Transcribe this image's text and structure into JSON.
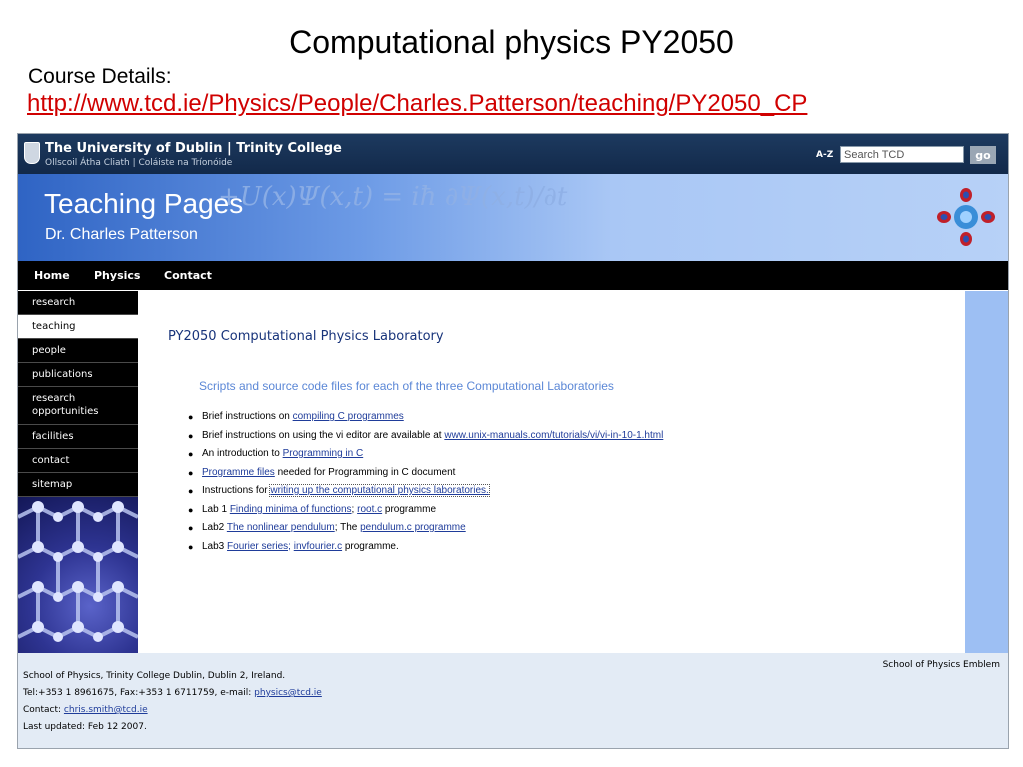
{
  "slide": {
    "title": "Computational physics PY2050",
    "course_label": "Course Details:",
    "course_url": "http://www.tcd.ie/Physics/People/Charles.Patterson/teaching/PY2050_CP"
  },
  "header": {
    "university": "The University of Dublin | Trinity College",
    "university_irish": "Ollscoil Átha Cliath | Coláiste na Tríonóide",
    "az_label": "A-Z",
    "search_placeholder": "Search TCD",
    "go_label": "go"
  },
  "banner": {
    "title": "Teaching Pages",
    "subtitle": "Dr. Charles Patterson"
  },
  "nav": {
    "items": [
      "Home",
      "Physics",
      "Contact"
    ]
  },
  "sidebar": {
    "items": [
      {
        "label": "research"
      },
      {
        "label": "teaching",
        "active": true
      },
      {
        "label": "people"
      },
      {
        "label": "publications"
      },
      {
        "label": "research opportunities"
      },
      {
        "label": "facilities"
      },
      {
        "label": "contact"
      },
      {
        "label": "sitemap"
      }
    ]
  },
  "main": {
    "heading": "PY2050 Computational Physics Laboratory",
    "subheading": "Scripts and source code files for each of the three Computational Laboratories",
    "list": [
      {
        "t1": "Brief instructions on ",
        "l1": "compiling C programmes"
      },
      {
        "t1": "Brief instructions on using the vi editor are available at ",
        "l1": "www.unix-manuals.com/tutorials/vi/vi-in-10-1.html"
      },
      {
        "t1": "An introduction to ",
        "l1": "Programming in C"
      },
      {
        "l1": "Programme files",
        "t2": " needed for Programming in C document"
      },
      {
        "t1": "Instructions for ",
        "l1": "writing up the computational physics laboratories."
      },
      {
        "t1": "Lab 1 ",
        "l1": "Finding minima of functions",
        "t2": "; ",
        "l2": "root.c",
        "t3": " programme"
      },
      {
        "t1": "Lab2 ",
        "l1": "The nonlinear pendulum",
        "t2": "; The ",
        "l2": "pendulum.c programme"
      },
      {
        "t1": "Lab3 ",
        "l1": "Fourier series;",
        "t2": " ",
        "l2": "invfourier.c",
        "t3": " programme."
      }
    ]
  },
  "footer": {
    "emblem": "School of Physics Emblem",
    "address": "School of Physics, Trinity College Dublin, Dublin 2, Ireland.",
    "phone_prefix": "Tel:+353 1 8961675, Fax:+353 1 6711759, e-mail: ",
    "email": "physics@tcd.ie",
    "contact_prefix": "Contact: ",
    "contact_email": "chris.smith@tcd.ie",
    "updated": "Last updated: Feb 12 2007."
  },
  "colors": {
    "header_bg": "#1d3a5f",
    "banner_blue": "#2f64c4",
    "nav_bg": "#000000",
    "heading": "#17337a",
    "subheading": "#5b87d6",
    "link": "#1f3c9a",
    "course_link": "#d00000",
    "footer_bg": "#e3ebf5",
    "right_strip": "#9dbff3"
  }
}
